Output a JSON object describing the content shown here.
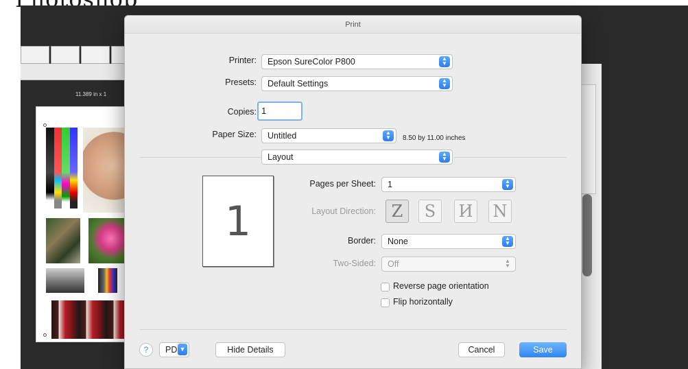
{
  "app": {
    "title": "Photoshop",
    "size_label": "11.389 in x 1"
  },
  "dialog": {
    "title": "Print",
    "printer": {
      "label": "Printer:",
      "value": "Epson SureColor P800"
    },
    "presets": {
      "label": "Presets:",
      "value": "Default Settings"
    },
    "copies": {
      "label": "Copies:",
      "value": "1"
    },
    "paper_size": {
      "label": "Paper Size:",
      "value": "Untitled",
      "info": "8.50 by 11.00 inches"
    },
    "section": {
      "value": "Layout"
    },
    "preview_page_number": "1",
    "pages_per_sheet": {
      "label": "Pages per Sheet:",
      "value": "1"
    },
    "layout_direction": {
      "label": "Layout Direction:",
      "options": [
        "Z",
        "S",
        "И",
        "N"
      ]
    },
    "border": {
      "label": "Border:",
      "value": "None"
    },
    "two_sided": {
      "label": "Two-Sided:",
      "value": "Off"
    },
    "checkboxes": [
      {
        "label": "Reverse page orientation",
        "checked": false
      },
      {
        "label": "Flip horizontally",
        "checked": false
      }
    ],
    "buttons": {
      "help": "?",
      "pdf": "PDF",
      "hide_details": "Hide Details",
      "cancel": "Cancel",
      "save": "Save"
    }
  },
  "colors": {
    "accent": "#2f86ef",
    "dialog_bg": "#ececec",
    "app_bg": "#2a2a2a"
  }
}
